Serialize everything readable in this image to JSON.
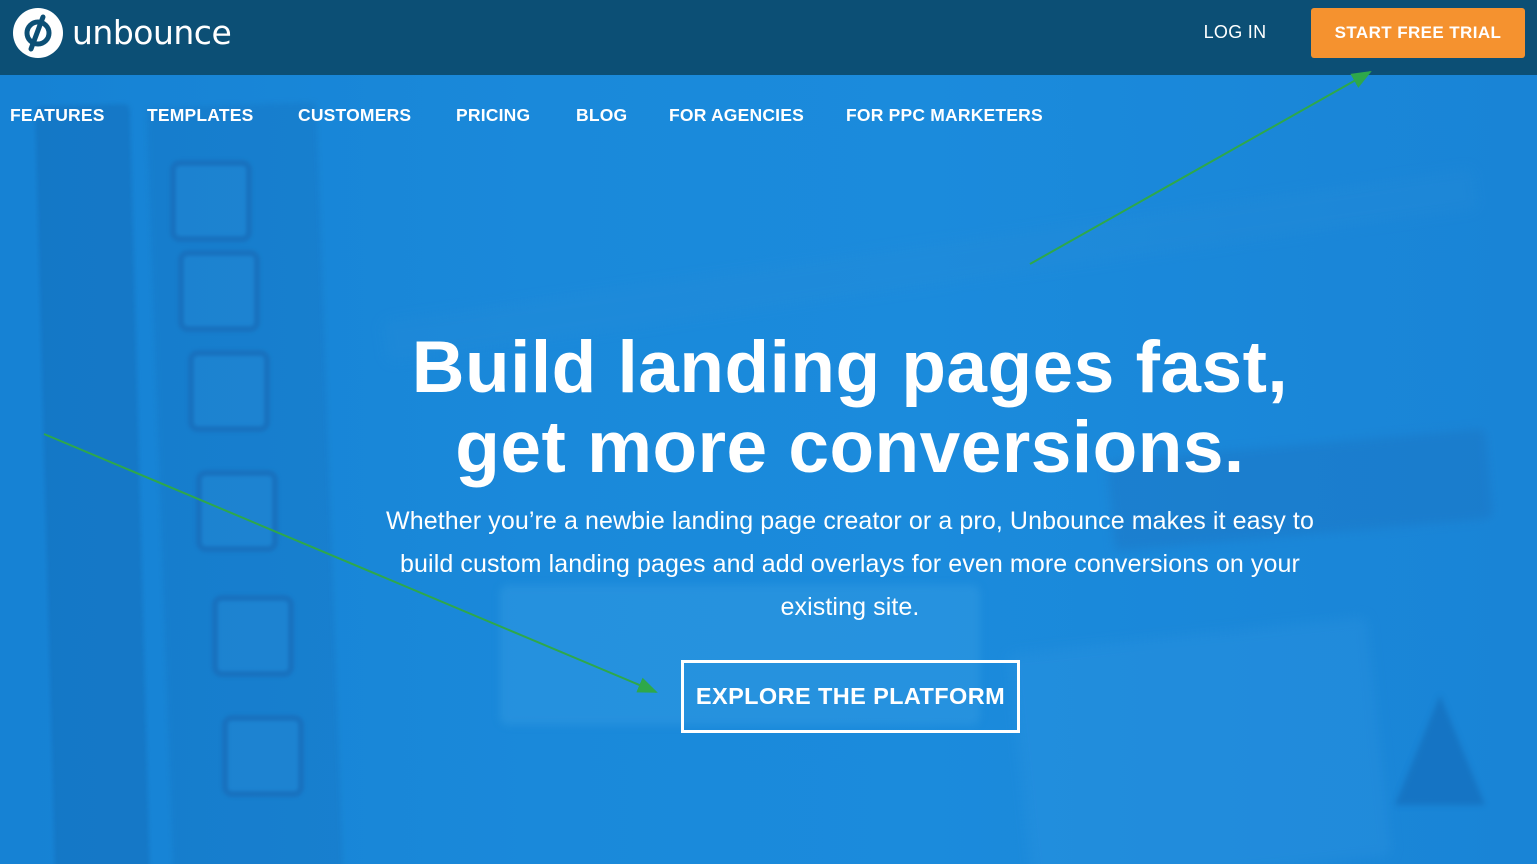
{
  "header": {
    "logo_text": "unbounce",
    "login_label": "LOG IN",
    "trial_label": "START FREE TRIAL"
  },
  "nav": {
    "items": [
      {
        "label": "FEATURES"
      },
      {
        "label": "TEMPLATES"
      },
      {
        "label": "CUSTOMERS"
      },
      {
        "label": "PRICING"
      },
      {
        "label": "BLOG"
      },
      {
        "label": "FOR AGENCIES"
      },
      {
        "label": "FOR PPC MARKETERS"
      }
    ]
  },
  "hero": {
    "headline_line1": "Build landing pages fast,",
    "headline_line2": "get more conversions.",
    "subtext": "Whether you’re a newbie landing page creator or a pro, Unbounce makes it easy to build custom landing pages and add overlays for even more conversions on your existing site.",
    "cta_label": "EXPLORE THE PLATFORM"
  },
  "colors": {
    "topbar": "#0c4f75",
    "hero_blue": "#1a86d6",
    "trial_orange": "#f5922f",
    "annotation_arrow": "#2ea84a"
  },
  "icons": {
    "logo": "unbounce-logo-icon"
  }
}
